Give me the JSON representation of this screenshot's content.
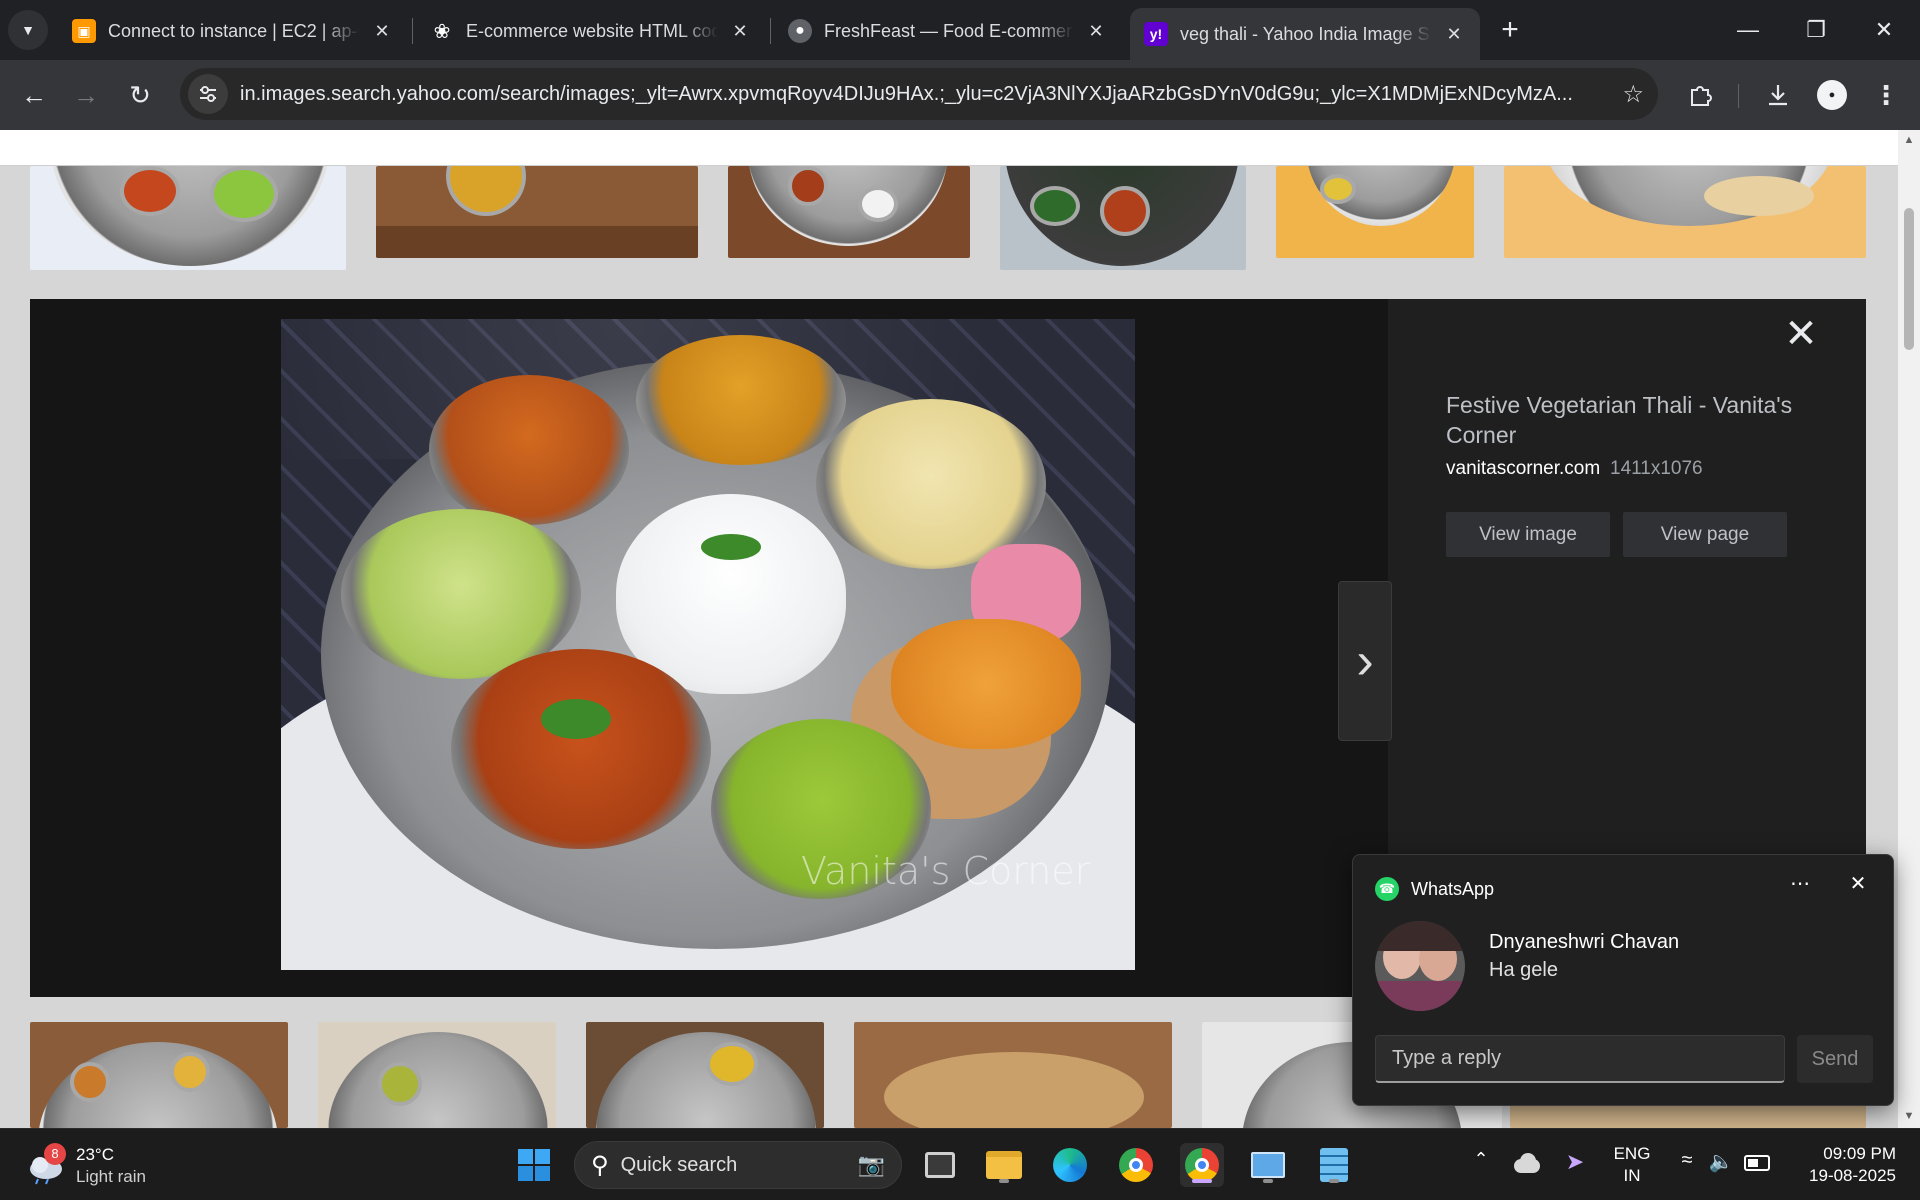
{
  "browser": {
    "tabs": [
      {
        "title": "Connect to instance | EC2 | ap-s",
        "favicon": "aws-icon",
        "color": "#ff9900"
      },
      {
        "title": "E-commerce website HTML cod",
        "favicon": "openai-icon",
        "color": "#ffffff"
      },
      {
        "title": "FreshFeast — Food E-commerc",
        "favicon": "globe-icon",
        "color": "#ffffff"
      },
      {
        "title": "veg thali - Yahoo India Image S",
        "favicon": "yahoo-icon",
        "color": "#6001d2"
      }
    ],
    "active_tab": 3,
    "url": "in.images.search.yahoo.com/search/images;_ylt=Awrx.xpvmqRoyv4DIJu9HAx.;_ylu=c2VjA3NlYXJjaARzbGsDYnV0dG9u;_ylc=X1MDMjExNDcyMzA..."
  },
  "viewer": {
    "title": "Festive Vegetarian Thali - Vanita's Corner",
    "source": "vanitascorner.com",
    "dimensions": "1411x1076",
    "view_image": "View image",
    "view_page": "View page",
    "watermark": "Vanita's Corner"
  },
  "whatsapp": {
    "app": "WhatsApp",
    "sender": "Dnyaneshwri Chavan",
    "message": "Ha gele",
    "reply_placeholder": "Type a reply",
    "send": "Send"
  },
  "taskbar": {
    "weather_temp": "23°C",
    "weather_desc": "Light rain",
    "weather_badge": "8",
    "search_label": "Quick search",
    "lang_top": "ENG",
    "lang_bottom": "IN",
    "time": "09:09 PM",
    "date": "19-08-2025"
  },
  "colors": {
    "accent": "#c9a7ff",
    "whatsapp": "#25d366",
    "yahoo": "#6001d2"
  }
}
